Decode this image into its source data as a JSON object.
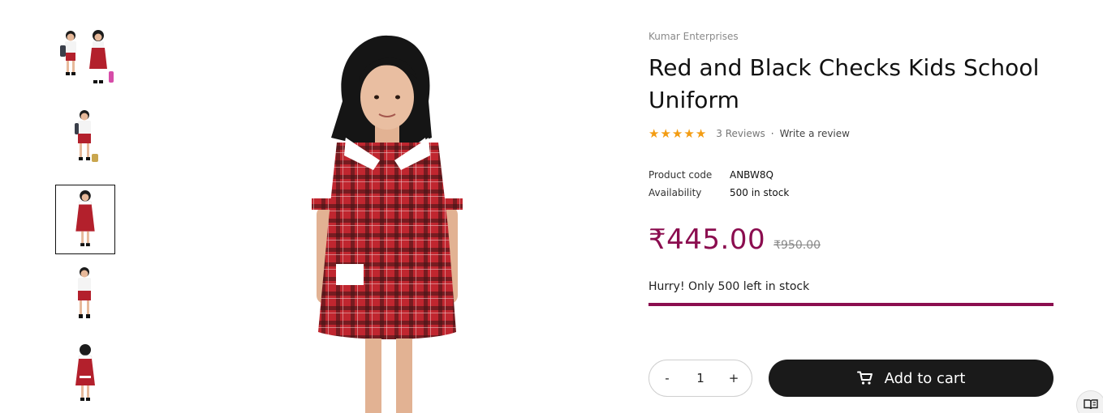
{
  "product": {
    "vendor": "Kumar Enterprises",
    "title": "Red and Black Checks Kids School Uniform",
    "rating": {
      "stars": 5,
      "reviews_label": "3 Reviews",
      "separator": "·",
      "write_review_label": "Write a review"
    },
    "meta": {
      "code_label": "Product code",
      "code_value": "ANBW8Q",
      "availability_label": "Availability",
      "availability_value": "500 in stock"
    },
    "price": "₹445.00",
    "compare_price": "₹950.00",
    "stock_message": "Hurry! Only 500 left in stock",
    "stock_level": 1.0
  },
  "quantity": {
    "minus_label": "-",
    "value": "1",
    "plus_label": "+"
  },
  "cart": {
    "add_label": "Add to cart"
  },
  "colors": {
    "accent": "#8b0d4f",
    "star": "#f39c12",
    "button_bg": "#1a1a1a"
  },
  "icons": {
    "cart": "cart-icon",
    "star": "star-icon",
    "reader": "book-reader-icon"
  }
}
